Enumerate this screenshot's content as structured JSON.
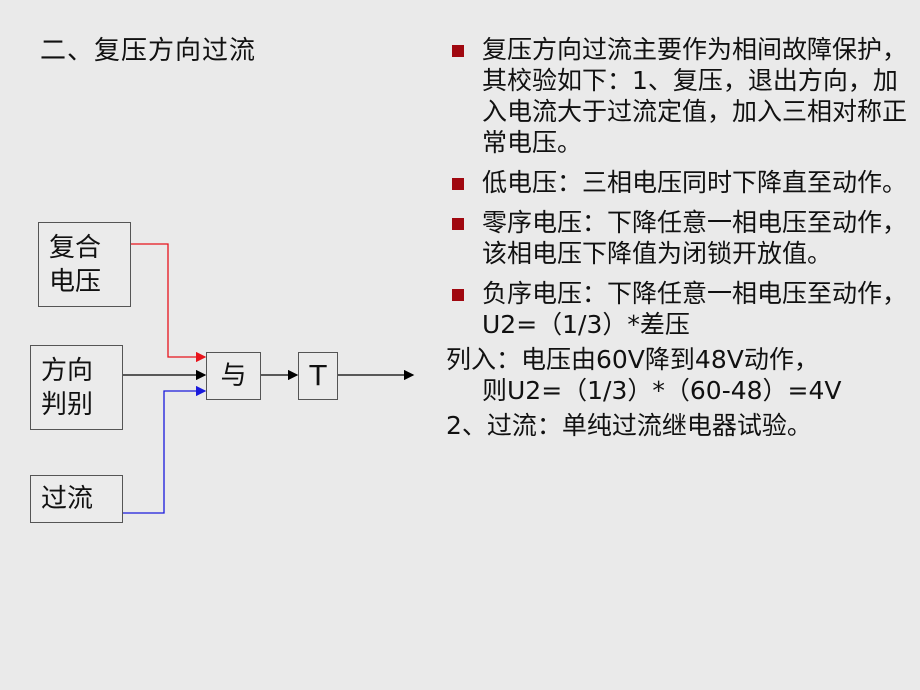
{
  "slide": {
    "title": "二、复压方向过流"
  },
  "diagram": {
    "blocks": {
      "combo_voltage": [
        "复合",
        "电压"
      ],
      "direction": [
        "方向",
        "判别"
      ],
      "overcurrent": "过流",
      "and_gate": "与",
      "timer": "T"
    },
    "colors": {
      "combo_voltage_wire": "#e8141c",
      "direction_wire": "#000000",
      "overcurrent_wire": "#1a1adc"
    }
  },
  "content": {
    "bullet_color": "#a00810",
    "bullets": [
      "复压方向过流主要作为相间故障保护，其校验如下：1、复压，退出方向，加入电流大于过流定值，加入三相对称正常电压。",
      "低电压：三相电压同时下降直至动作。",
      "零序电压：下降任意一相电压至动作，该相电压下降值为闭锁开放值。",
      "负序电压：下降任意一相电压至动作，U2=（1/3）*差压"
    ],
    "example_line1": "列入：电压由60V降到48V动作，",
    "example_line2": "则U2=（1/3）*（60-48）=4V",
    "step2": "2、过流：单纯过流继电器试验。"
  }
}
